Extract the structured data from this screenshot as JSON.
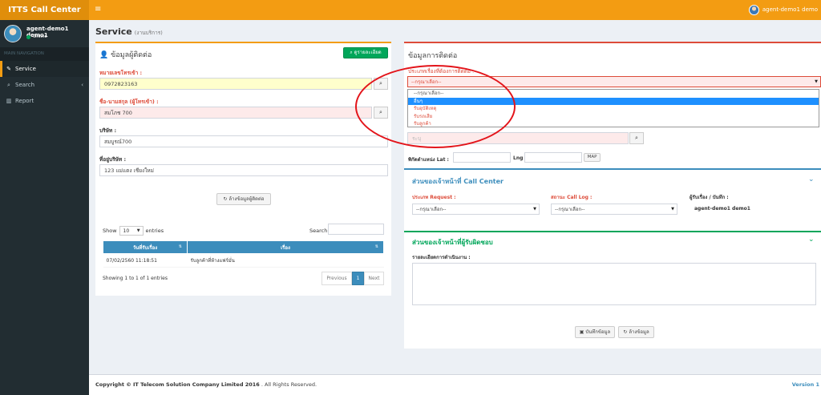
{
  "topbar": {
    "brand": "ITTS Call Center",
    "menu_icon": "≡",
    "user": "agent-demo1 demo"
  },
  "sidebar": {
    "user_name": "agent-demo1 demo1",
    "status": "Online",
    "nav_header": "MAIN NAVIGATION",
    "items": [
      {
        "label": "Service",
        "icon": "edit-icon"
      },
      {
        "label": "Search",
        "icon": "search-icon"
      },
      {
        "label": "Report",
        "icon": "bar-chart-icon"
      }
    ]
  },
  "page": {
    "title": "Service",
    "subtitle": "(งานบริการ)"
  },
  "contact": {
    "title": "ข้อมูลผู้ติดต่อ",
    "detail_button": "ดูรายละเอียด",
    "phone_label": "หมายเลขโทรเข้า :",
    "phone_value": "0972823163",
    "name_label": "ชื่อ-นามสกุล (ผู้โทรเข้า) :",
    "name_value": "สมโภช 700",
    "company_label": "บริษัท :",
    "company_value": "สมบูรณ์700",
    "address_label": "ที่อยู่บริษัท :",
    "address_value": "123 แม่แตง เชียงใหม่",
    "clear_button": "ล้างข้อมูลผู้ติดต่อ"
  },
  "table": {
    "show": "Show",
    "entries_value": "10",
    "entries": "entries",
    "search_label": "Search:",
    "columns": [
      "วันที่รับเรื่อง",
      "เรื่อง"
    ],
    "rows": [
      [
        "07/02/2560 11:18:51",
        "รับลูกค้าที่ห้างแฟร์มั่น"
      ]
    ],
    "info": "Showing 1 to 1 of 1 entries",
    "prev": "Previous",
    "page": "1",
    "next": "Next"
  },
  "contact_info": {
    "title": "ข้อมูลการติดต่อ",
    "type_label": "ประเภทเรื่องที่ต้องการติดต่อ :",
    "type_selected": "--กรุณาเลือก--",
    "options": [
      "--กรุณาเลือก--",
      "อื่นๆ",
      "รับอุบัติเหตุ",
      "รับรถเสีย",
      "รับลูกค้า"
    ],
    "hidden_input_placeholder": "ระบุ",
    "lat_label": "พิกัดตำแหน่ง Lat :",
    "lng_label": "Lng :",
    "map_button": "MAP"
  },
  "call_center": {
    "title": "ส่วนของเจ้าหน้าที่ Call Center",
    "request_label": "ประเภท Request :",
    "request_value": "--กรุณาเลือก--",
    "status_label": "สถานะ Call Log :",
    "status_value": "--กรุณาเลือก--",
    "recorder_label": "ผู้รับเรื่อง / บันทึก :",
    "recorder_value": "agent-demo1 demo1"
  },
  "responder": {
    "title": "ส่วนของเจ้าหน้าที่ผู้รับผิดชอบ",
    "detail_label": "รายละเอียดการดำเนินงาน :"
  },
  "actions": {
    "save": "บันทึกข้อมูล",
    "clear": "ล้างข้อมูล"
  },
  "footer": {
    "copyright_bold": "Copyright © IT Telecom Solution Company Limited 2016",
    "copyright_rest": ". All Rights Reserved.",
    "version": "Version 1"
  },
  "colors": {
    "orange": "#f39c12",
    "sidebar": "#222d32",
    "blue": "#3c8dbc",
    "red": "#dd4b39",
    "green": "#00a65a"
  }
}
